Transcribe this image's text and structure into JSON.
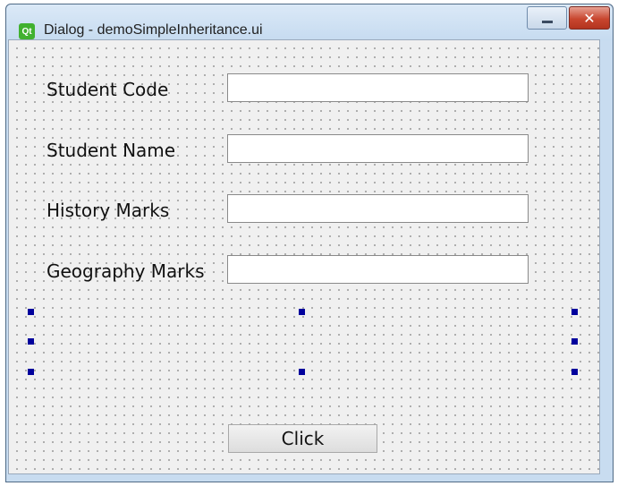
{
  "window": {
    "title": "Dialog - demoSimpleInheritance.ui",
    "app_icon": "qt-logo",
    "app_icon_text": "Qt",
    "close_glyph": "✕"
  },
  "form": {
    "fields": [
      {
        "label": "Student Code",
        "value": ""
      },
      {
        "label": "Student Name",
        "value": ""
      },
      {
        "label": "History Marks",
        "value": ""
      },
      {
        "label": "Geography Marks",
        "value": ""
      }
    ],
    "button_label": "Click"
  },
  "colors": {
    "selection_handle": "#00009c",
    "close_button": "#c8462f"
  }
}
